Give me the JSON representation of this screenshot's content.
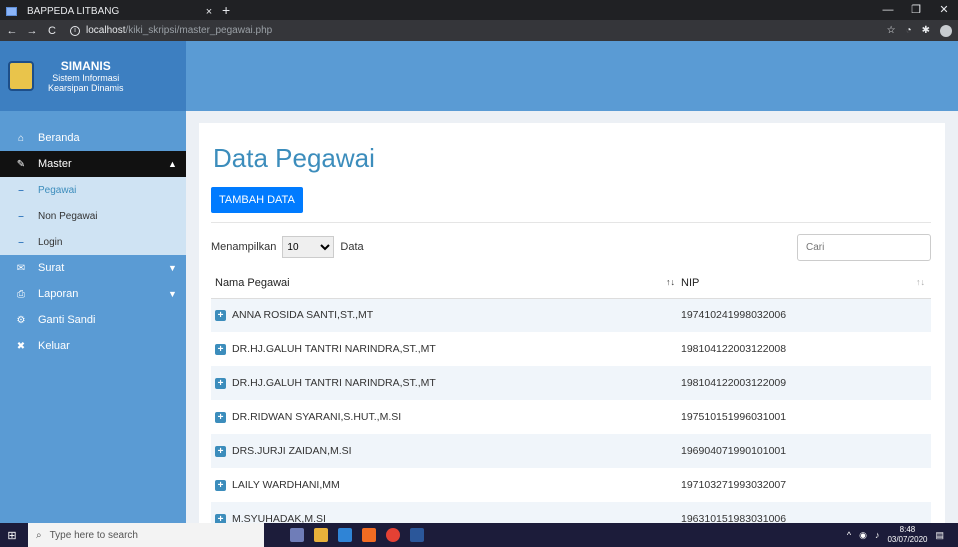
{
  "browser": {
    "tab_title": "BAPPEDA LITBANG",
    "tab_close": "×",
    "new_tab": "+",
    "url_host": "localhost",
    "url_path": "/kiki_skripsi/master_pegawai.php",
    "back": "←",
    "forward": "→",
    "reload": "C",
    "minimize": "—",
    "maximize": "❐",
    "close": "✕",
    "star": "☆",
    "ext1": "◔",
    "ext2": "✱"
  },
  "brand": {
    "name": "SIMANIS",
    "sub1": "Sistem Informasi",
    "sub2": "Kearsipan Dinamis"
  },
  "menu": {
    "beranda": "Beranda",
    "master": "Master",
    "sub_pegawai": "Pegawai",
    "sub_non_pegawai": "Non Pegawai",
    "sub_login": "Login",
    "surat": "Surat",
    "laporan": "Laporan",
    "ganti_sandi": "Ganti Sandi",
    "keluar": "Keluar"
  },
  "main": {
    "title": "Data Pegawai",
    "add_button": "TAMBAH DATA",
    "length_prefix": "Menampilkan",
    "length_value": "10",
    "length_suffix": "Data",
    "search_placeholder": "Cari",
    "columns": [
      "Nama Pegawai",
      "NIP"
    ],
    "sort_icon": "↑↓",
    "rows": [
      {
        "name": "ANNA ROSIDA SANTI,ST.,MT",
        "nip": "197410241998032006"
      },
      {
        "name": "DR.HJ.GALUH TANTRI NARINDRA,ST.,MT",
        "nip": "198104122003122008"
      },
      {
        "name": "DR.HJ.GALUH TANTRI NARINDRA,ST.,MT",
        "nip": "198104122003122009"
      },
      {
        "name": "DR.RIDWAN SYARANI,S.HUT.,M.SI",
        "nip": "197510151996031001"
      },
      {
        "name": "DRS.JURJI ZAIDAN,M.SI",
        "nip": "196904071990101001"
      },
      {
        "name": "LAILY WARDHANI,MM",
        "nip": "197103271993032007"
      },
      {
        "name": "M.SYUHADAK,M.SI",
        "nip": "196310151983031006"
      }
    ]
  },
  "taskbar": {
    "search_placeholder": "Type here to search",
    "time": "8:48",
    "date": "03/07/2020"
  },
  "colors": {
    "sidebar": "#5a9bd4",
    "accent": "#3c8dbc",
    "button": "#007bff"
  }
}
